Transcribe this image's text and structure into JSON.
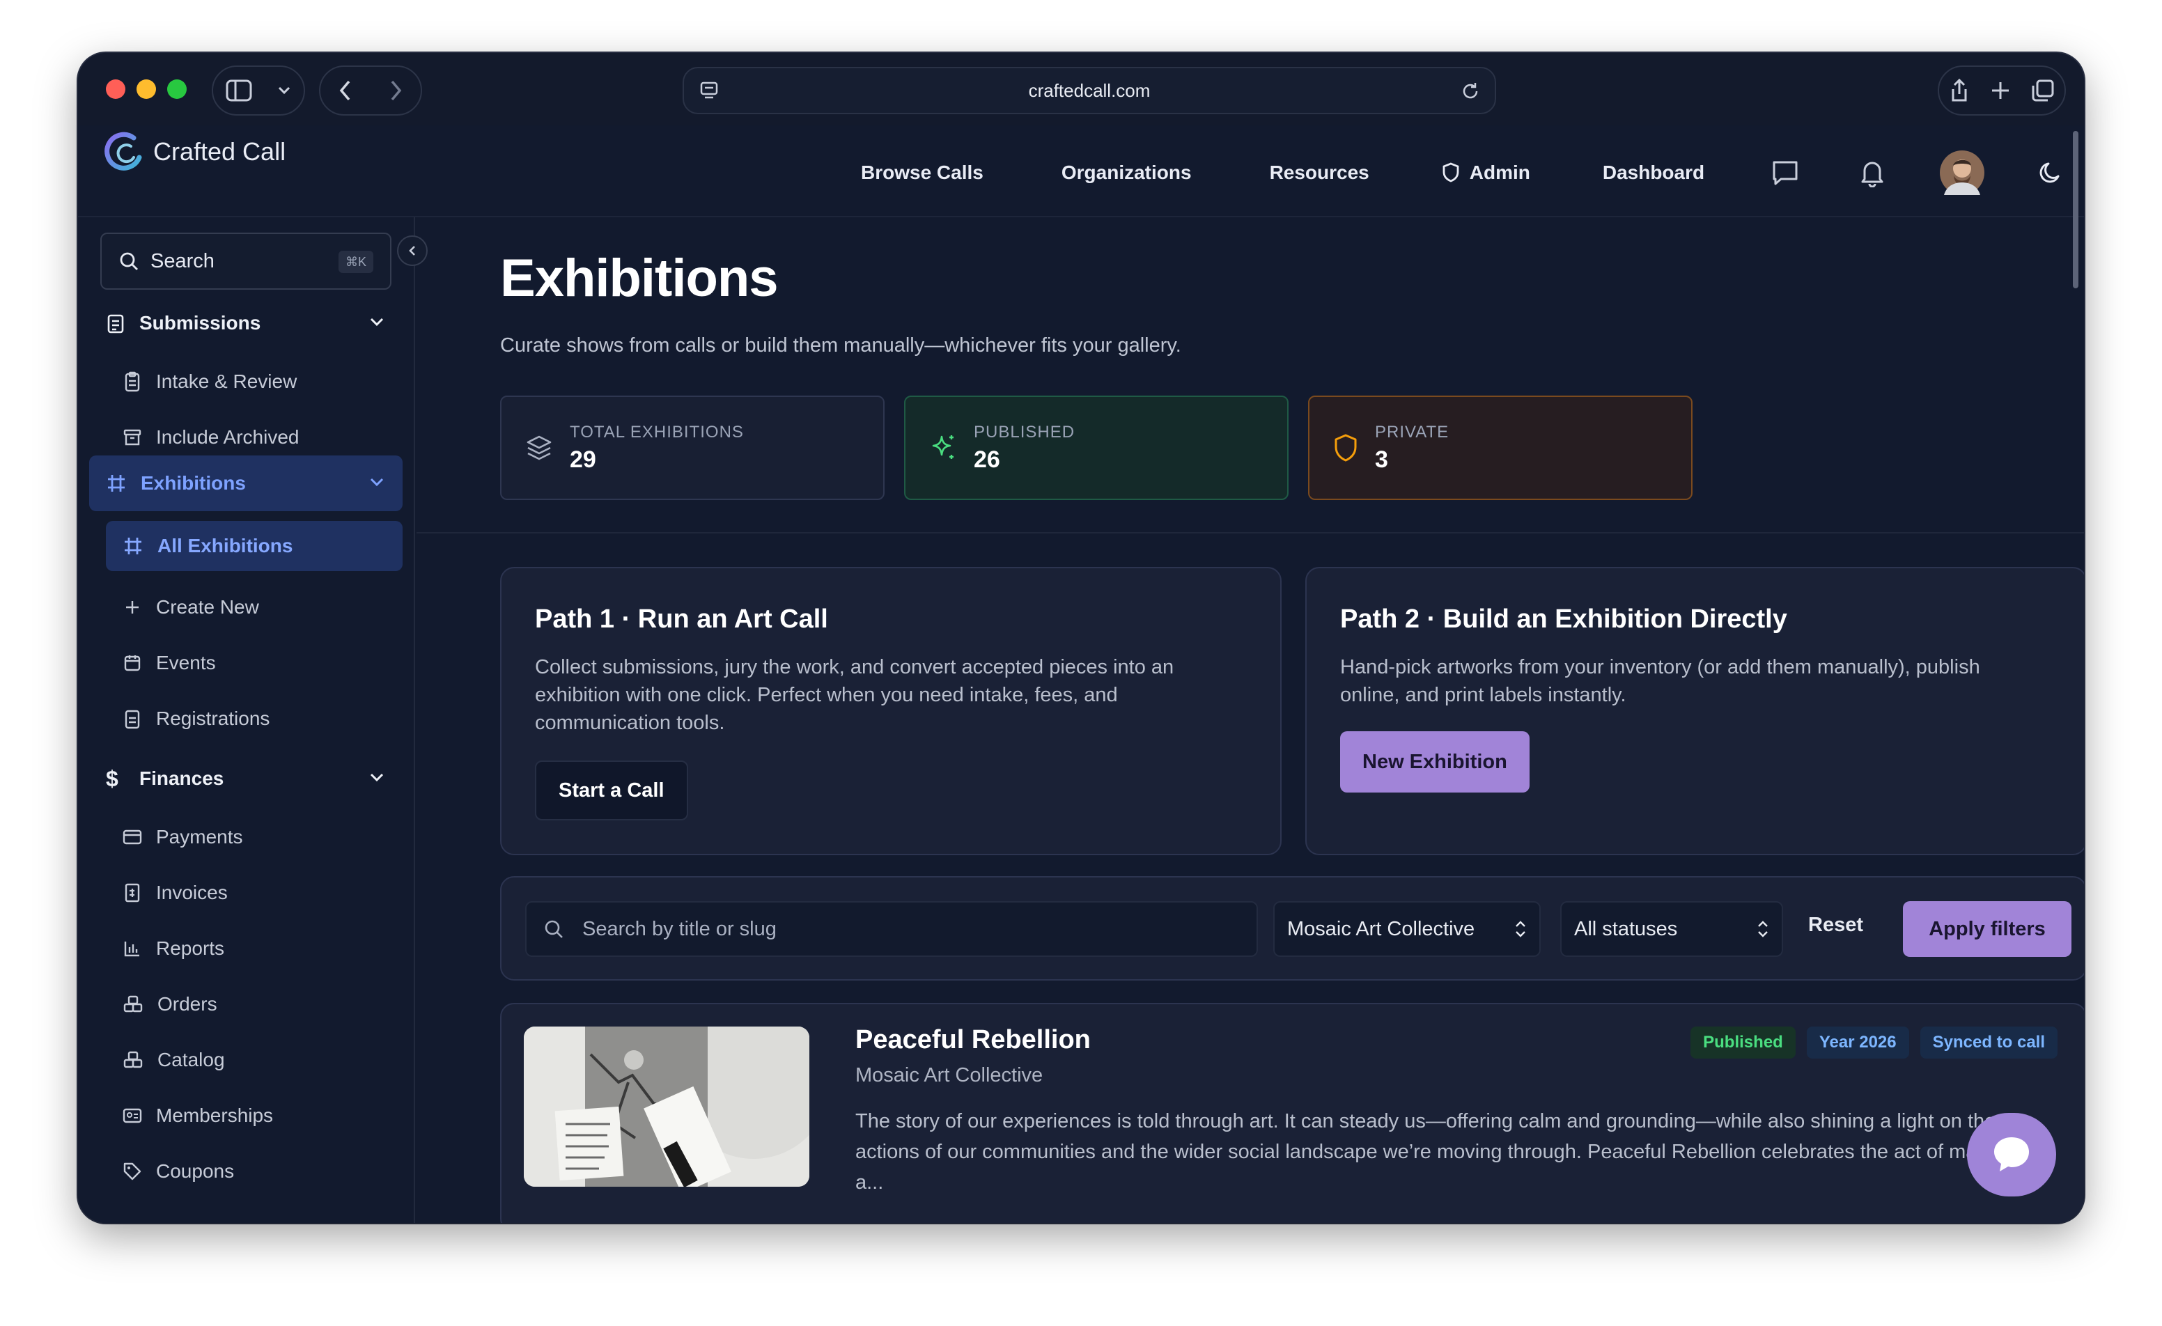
{
  "browser": {
    "url": "craftedcall.com"
  },
  "brand": {
    "name": "Crafted Call"
  },
  "nav": {
    "browse_calls": "Browse Calls",
    "organizations": "Organizations",
    "resources": "Resources",
    "admin": "Admin",
    "dashboard": "Dashboard"
  },
  "sidebar": {
    "search_label": "Search",
    "search_shortcut": "⌘K",
    "groups": {
      "submissions": "Submissions",
      "exhibitions": "Exhibitions",
      "finances": "Finances"
    },
    "items": {
      "intake_review": "Intake & Review",
      "include_archived": "Include Archived",
      "all_exhibitions": "All Exhibitions",
      "create_new": "Create New",
      "events": "Events",
      "registrations": "Registrations",
      "payments": "Payments",
      "invoices": "Invoices",
      "reports": "Reports",
      "orders": "Orders",
      "catalog": "Catalog",
      "memberships": "Memberships",
      "coupons": "Coupons"
    }
  },
  "page": {
    "title": "Exhibitions",
    "subtitle": "Curate shows from calls or build them manually—whichever fits your gallery."
  },
  "stats": [
    {
      "label": "TOTAL EXHIBITIONS",
      "value": "29"
    },
    {
      "label": "PUBLISHED",
      "value": "26"
    },
    {
      "label": "PRIVATE",
      "value": "3"
    }
  ],
  "paths": {
    "path1": {
      "title": "Path 1 · Run an Art Call",
      "text": "Collect submissions, jury the work, and convert accepted pieces into an exhibition with one click. Perfect when you need intake, fees, and communication tools.",
      "button": "Start a Call"
    },
    "path2": {
      "title": "Path 2 · Build an Exhibition Directly",
      "text": "Hand-pick artworks from your inventory (or add them manually), publish online, and print labels instantly.",
      "button": "New Exhibition"
    }
  },
  "filters": {
    "search_placeholder": "Search by title or slug",
    "organization": "Mosaic Art Collective",
    "status": "All statuses",
    "reset": "Reset",
    "apply": "Apply filters"
  },
  "exhibitions": [
    {
      "title": "Peaceful Rebellion",
      "organization": "Mosaic Art Collective",
      "description": "The story of our experiences is told through art. It can steady us—offering calm and grounding—while also shining a light on the actions of our communities and the wider social landscape we’re moving through. Peaceful Rebellion celebrates the act of making art a...",
      "badges": [
        "Published",
        "Year 2026",
        "Synced to call"
      ]
    }
  ],
  "colors": {
    "accent": "#a184d8",
    "active_nav": "#7ea2ff",
    "published": "#4ade80",
    "private": "#f59e0b"
  }
}
